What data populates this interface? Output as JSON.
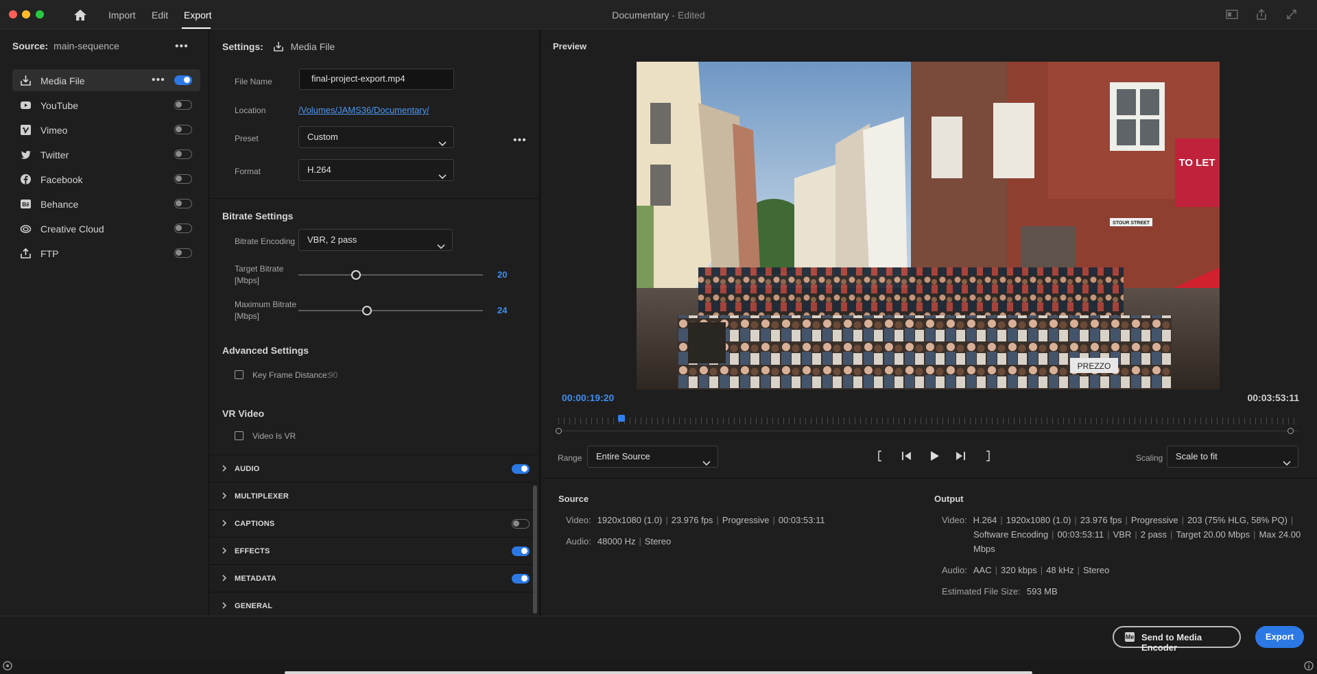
{
  "app": {
    "nav": [
      "Import",
      "Edit",
      "Export"
    ],
    "active_nav": "Export",
    "document_title": "Documentary",
    "document_state": "Edited",
    "title_separator": " - "
  },
  "source": {
    "label": "Source:",
    "value": "main-sequence"
  },
  "destinations": [
    {
      "label": "Media File",
      "icon": "download-icon",
      "enabled": true,
      "active": true
    },
    {
      "label": "YouTube",
      "icon": "youtube-icon",
      "enabled": false
    },
    {
      "label": "Vimeo",
      "icon": "vimeo-icon",
      "enabled": false
    },
    {
      "label": "Twitter",
      "icon": "twitter-icon",
      "enabled": false
    },
    {
      "label": "Facebook",
      "icon": "facebook-icon",
      "enabled": false
    },
    {
      "label": "Behance",
      "icon": "behance-icon",
      "enabled": false
    },
    {
      "label": "Creative Cloud",
      "icon": "creative-cloud-icon",
      "enabled": false
    },
    {
      "label": "FTP",
      "icon": "upload-icon",
      "enabled": false
    }
  ],
  "settings": {
    "header_label": "Settings:",
    "header_value": "Media File",
    "file_name_label": "File Name",
    "file_name": "final-project-export.mp4",
    "location_label": "Location",
    "location": "/Volumes/JAMS36/Documentary/",
    "preset_label": "Preset",
    "preset": "Custom",
    "format_label": "Format",
    "format": "H.264"
  },
  "bitrate": {
    "title": "Bitrate Settings",
    "encoding_label": "Bitrate Encoding",
    "encoding": "VBR, 2 pass",
    "target_label_1": "Target Bitrate",
    "target_label_2": "[Mbps]",
    "target_value": "20",
    "max_label_1": "Maximum Bitrate",
    "max_label_2": "[Mbps]",
    "max_value": "24"
  },
  "advanced": {
    "title": "Advanced Settings",
    "keyframe_label": "Key Frame Distance:",
    "keyframe_value": "90",
    "keyframe_checked": false
  },
  "vr": {
    "title": "VR Video",
    "label": "Video Is VR",
    "checked": false
  },
  "accordions": [
    {
      "label": "AUDIO",
      "toggle": true,
      "enabled": true
    },
    {
      "label": "MULTIPLEXER",
      "toggle": false
    },
    {
      "label": "CAPTIONS",
      "toggle": true,
      "enabled": false
    },
    {
      "label": "EFFECTS",
      "toggle": true,
      "enabled": true
    },
    {
      "label": "METADATA",
      "toggle": true,
      "enabled": true
    },
    {
      "label": "GENERAL",
      "toggle": false
    }
  ],
  "preview": {
    "title": "Preview",
    "current_time": "00:00:19:20",
    "duration": "00:03:53:11",
    "range_label": "Range",
    "range": "Entire Source",
    "scaling_label": "Scaling",
    "scaling": "Scale to fit",
    "image_text": {
      "to_let": "TO LET",
      "street": "STOUR STREET",
      "prezzo": "PREZZO"
    }
  },
  "summary": {
    "source_title": "Source",
    "source_video_label": "Video:",
    "source_video": [
      "1920x1080 (1.0)",
      "23.976 fps",
      "Progressive",
      "00:03:53:11"
    ],
    "source_audio_label": "Audio:",
    "source_audio": [
      "48000 Hz",
      "Stereo"
    ],
    "output_title": "Output",
    "output_video_label": "Video:",
    "output_video_line1": [
      "H.264",
      "1920x1080 (1.0)",
      "23.976 fps",
      "Progressive",
      "203 (75% HLG, 58% PQ)"
    ],
    "output_video_line2": [
      "Software Encoding",
      "00:03:53:11",
      "VBR",
      "2 pass",
      "Target 20.00 Mbps",
      "Max 24.00"
    ],
    "output_video_line3": "Mbps",
    "output_audio_label": "Audio:",
    "output_audio": [
      "AAC",
      "320 kbps",
      "48 kHz",
      "Stereo"
    ],
    "file_size_label": "Estimated File Size:",
    "file_size": "593 MB"
  },
  "actions": {
    "send_to_encoder": "Send to Media Encoder",
    "encoder_badge": "Me",
    "export": "Export"
  },
  "colors": {
    "accent": "#2c79e6",
    "timecode": "#3e8ef0",
    "link": "#4f98f0"
  }
}
